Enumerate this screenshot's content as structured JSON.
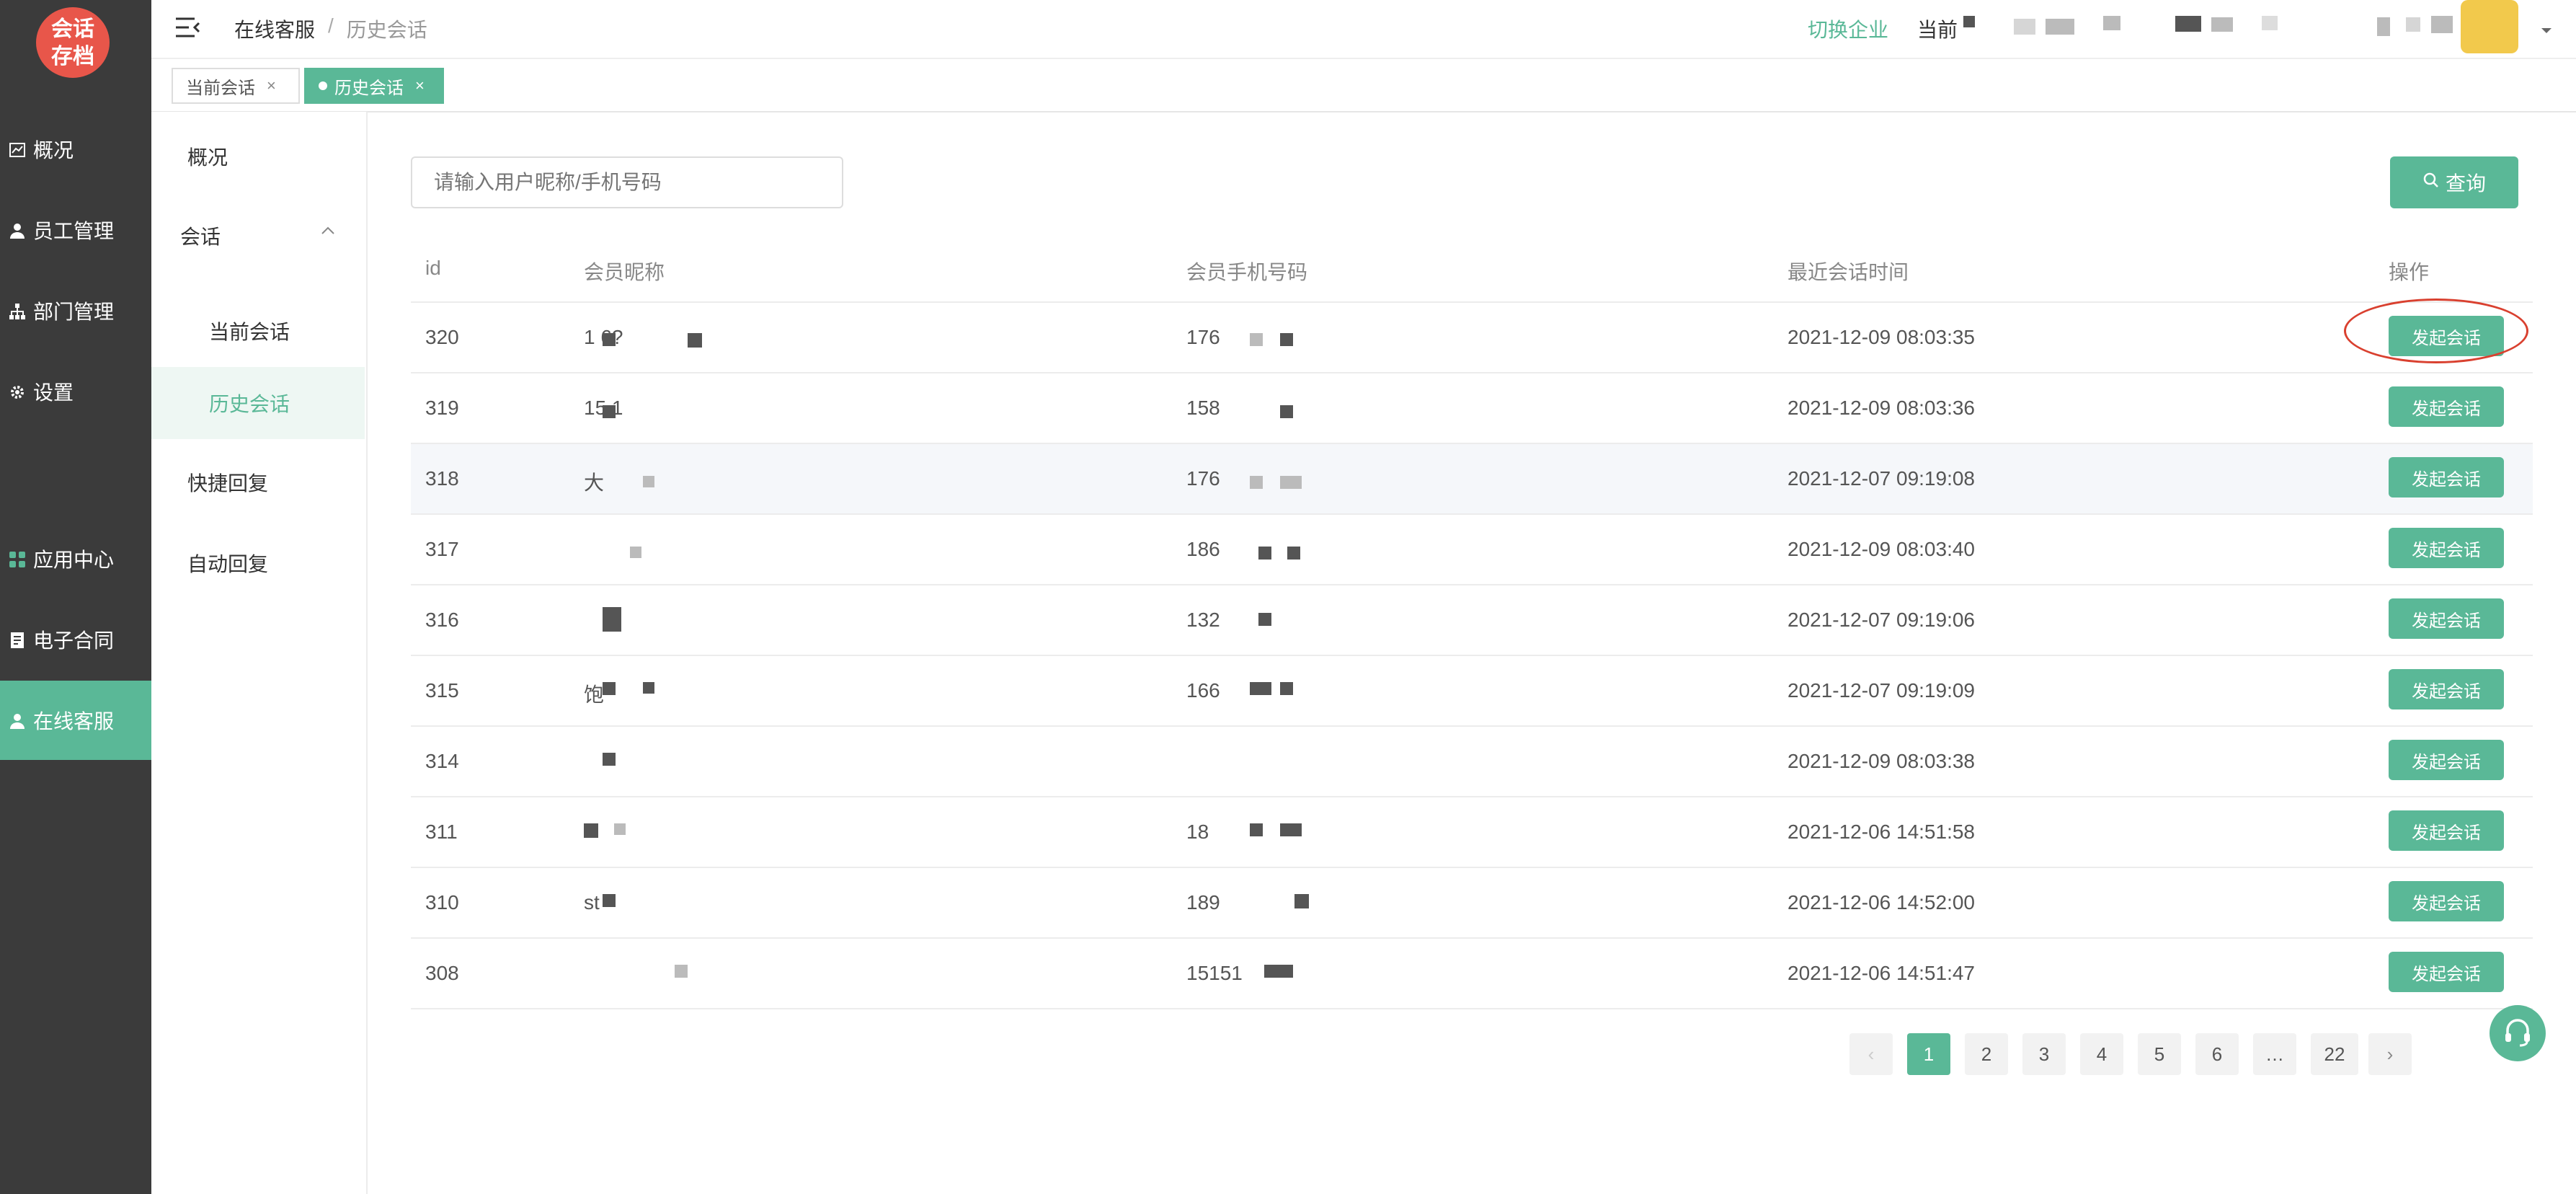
{
  "app": {
    "logo_line1": "会话",
    "logo_line2": "存档"
  },
  "sidebar": {
    "items": [
      {
        "label": "概况",
        "icon": "chart-icon"
      },
      {
        "label": "员工管理",
        "icon": "user-icon"
      },
      {
        "label": "部门管理",
        "icon": "org-icon"
      },
      {
        "label": "设置",
        "icon": "gear-icon"
      },
      {
        "label": "应用中心",
        "icon": "apps-icon"
      },
      {
        "label": "电子合同",
        "icon": "document-icon"
      },
      {
        "label": "在线客服",
        "icon": "user-icon",
        "active": true
      }
    ]
  },
  "header": {
    "breadcrumb_root": "在线客服",
    "breadcrumb_sep": "/",
    "breadcrumb_current": "历史会话",
    "switch_enterprise": "切换企业",
    "current_label": "当前"
  },
  "tabs": [
    {
      "label": "当前会话",
      "close": "×"
    },
    {
      "label": "历史会话",
      "close": "×",
      "active": true
    }
  ],
  "submenu": {
    "overview": "概况",
    "session": "会话",
    "current_session": "当前会话",
    "history_session": "历史会话",
    "quick_reply": "快捷回复",
    "auto_reply": "自动回复"
  },
  "search": {
    "placeholder": "请输入用户昵称/手机号码",
    "button_label": "查询"
  },
  "table": {
    "columns": [
      "id",
      "会员昵称",
      "会员手机号码",
      "最近会话时间",
      "操作"
    ],
    "rows": [
      {
        "id": "320",
        "nickname": "1  6?",
        "phone": "176",
        "time": "2021-12-09 08:03:35",
        "action": "发起会话"
      },
      {
        "id": "319",
        "nickname": "15   1",
        "phone": "158",
        "time": "2021-12-09 08:03:36",
        "action": "发起会话"
      },
      {
        "id": "318",
        "nickname": "大",
        "phone": "176",
        "time": "2021-12-07 09:19:08",
        "action": "发起会话"
      },
      {
        "id": "317",
        "nickname": "",
        "phone": "186",
        "time": "2021-12-09 08:03:40",
        "action": "发起会话"
      },
      {
        "id": "316",
        "nickname": "",
        "phone": "132",
        "time": "2021-12-07 09:19:06",
        "action": "发起会话"
      },
      {
        "id": "315",
        "nickname": "   饱",
        "phone": "166",
        "time": "2021-12-07 09:19:09",
        "action": "发起会话"
      },
      {
        "id": "314",
        "nickname": "",
        "phone": "",
        "time": "2021-12-09 08:03:38",
        "action": "发起会话"
      },
      {
        "id": "311",
        "nickname": "",
        "phone": "18",
        "time": "2021-12-06 14:51:58",
        "action": "发起会话"
      },
      {
        "id": "310",
        "nickname": "st",
        "phone": "189",
        "time": "2021-12-06 14:52:00",
        "action": "发起会话"
      },
      {
        "id": "308",
        "nickname": "",
        "phone": "15151",
        "time": "2021-12-06 14:51:47",
        "action": "发起会话"
      }
    ]
  },
  "pagination": {
    "prev": "‹",
    "pages": [
      "1",
      "2",
      "3",
      "4",
      "5",
      "6",
      "…",
      "22"
    ],
    "next": "›"
  },
  "colors": {
    "accent": "#5ab897",
    "sidebar_bg": "#3b3b3b",
    "logo_bg": "#e8564a",
    "highlight_circle": "#d9402f"
  }
}
